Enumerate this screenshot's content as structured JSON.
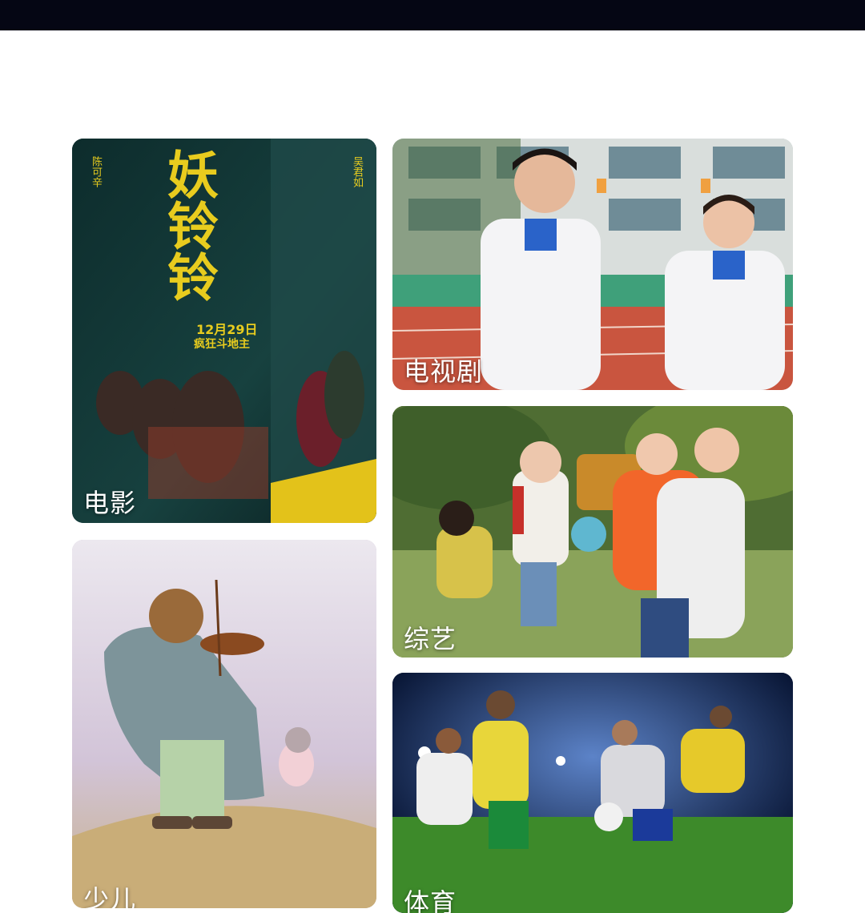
{
  "categories": [
    {
      "id": "movie",
      "label": "电影"
    },
    {
      "id": "tv",
      "label": "电视剧"
    },
    {
      "id": "variety",
      "label": "综艺"
    },
    {
      "id": "kids",
      "label": "少儿"
    },
    {
      "id": "sports",
      "label": "体育"
    }
  ],
  "poster_movie": {
    "title": "妖铃铃",
    "date": "12月29日",
    "tagline": "疯狂斗地主",
    "credits": [
      "陈可辛",
      "吴君如"
    ]
  },
  "colors": {
    "top_bar": "#050614",
    "label_text": "#ffffff"
  }
}
